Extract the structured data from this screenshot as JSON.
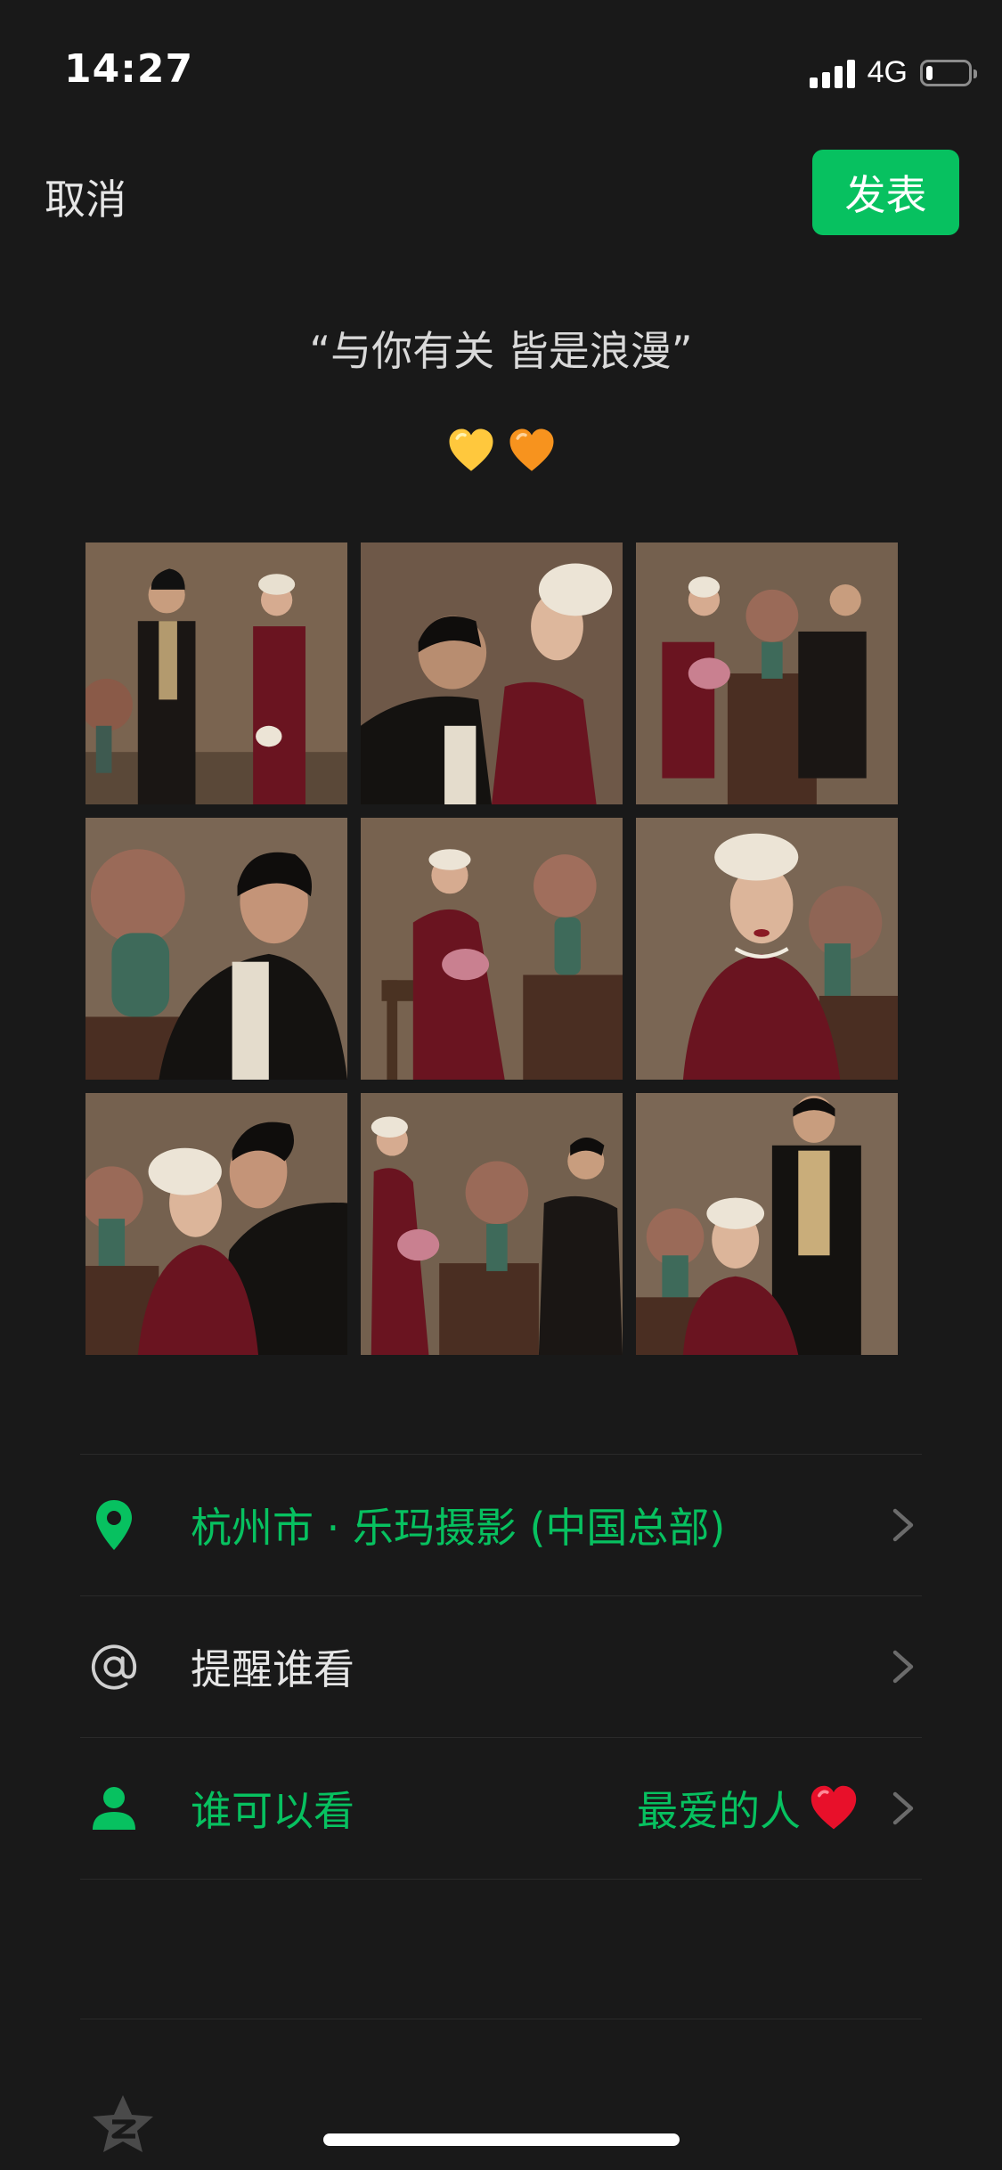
{
  "status_bar": {
    "time": "14:27",
    "network": "4G",
    "battery_level": 0.15
  },
  "nav": {
    "cancel_label": "取消",
    "publish_label": "发表",
    "accent_color": "#07c160"
  },
  "post": {
    "caption": "“与你有关 皆是浪漫”",
    "emoji": [
      "yellow-heart",
      "orange-heart"
    ]
  },
  "photos": [
    {
      "name": "photo-1"
    },
    {
      "name": "photo-2"
    },
    {
      "name": "photo-3"
    },
    {
      "name": "photo-4"
    },
    {
      "name": "photo-5"
    },
    {
      "name": "photo-6"
    },
    {
      "name": "photo-7"
    },
    {
      "name": "photo-8"
    },
    {
      "name": "photo-9"
    }
  ],
  "options": {
    "location": {
      "icon": "location-pin-icon",
      "label": "杭州市 · 乐玛摄影 (中国总部)"
    },
    "mention": {
      "icon": "at-sign-icon",
      "label": "提醒谁看"
    },
    "visibility": {
      "icon": "person-icon",
      "label": "谁可以看",
      "value": "最爱的人"
    }
  },
  "footer": {
    "icon": "qzone-star-icon"
  }
}
